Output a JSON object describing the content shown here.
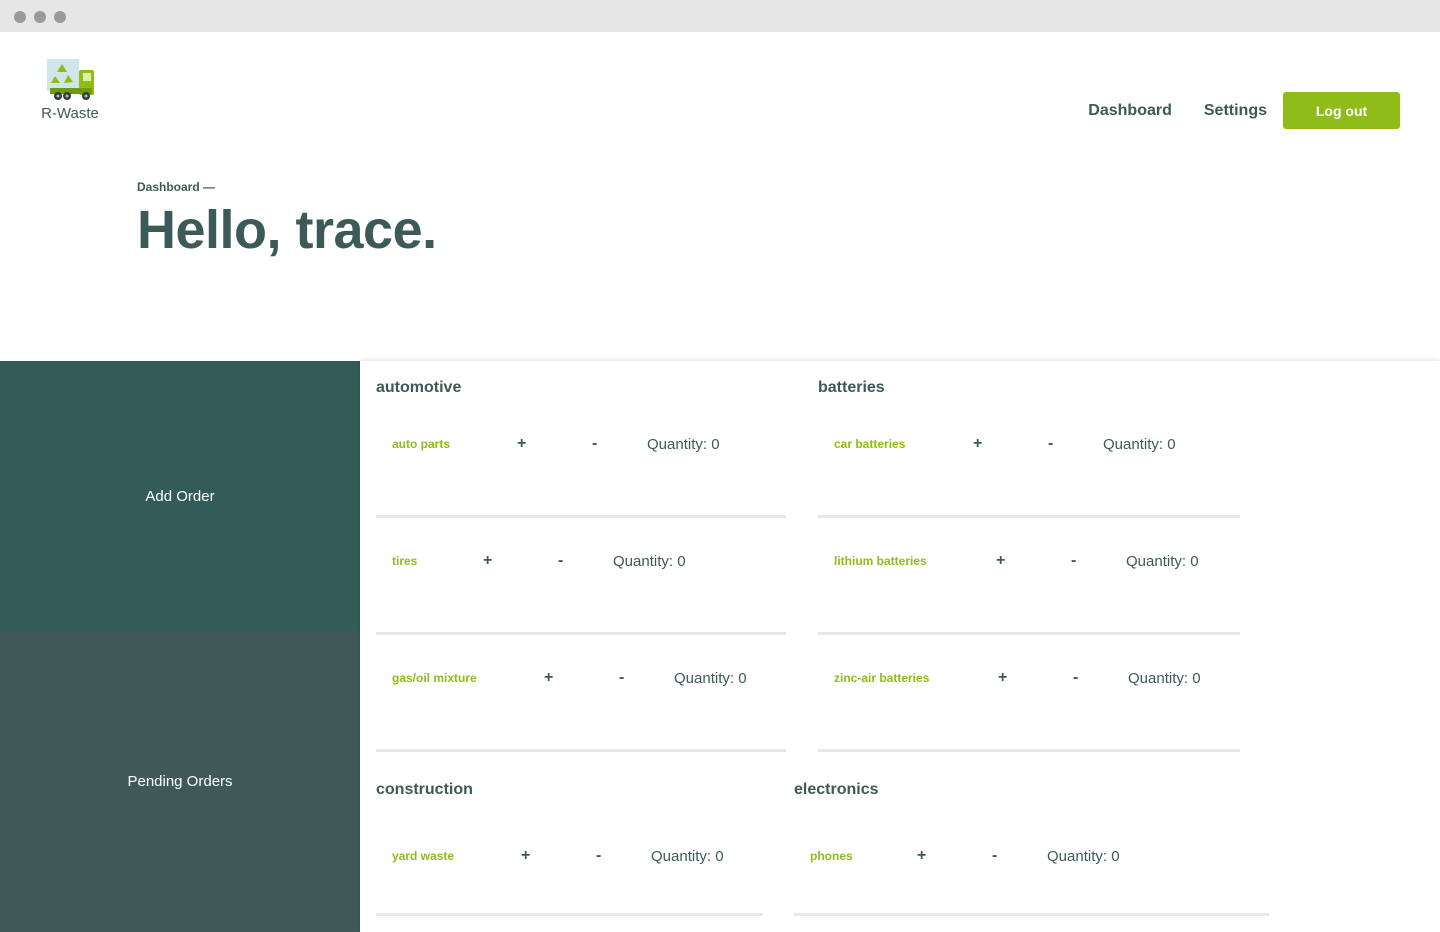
{
  "brand": {
    "name": "R-Waste",
    "logo_icon": "recycling-truck-icon",
    "accent": "#8fbc19",
    "primary": "#3d5a58"
  },
  "nav": {
    "dashboard": "Dashboard",
    "settings": "Settings",
    "logout": "Log out"
  },
  "header": {
    "breadcrumb": "Dashboard —",
    "greeting": "Hello, trace."
  },
  "sidebar": {
    "add_order": "Add Order",
    "pending_orders": "Pending Orders"
  },
  "categories": [
    {
      "title": "automotive",
      "items": [
        {
          "name": "auto parts",
          "plus": "+",
          "minus": "-",
          "quantity": "Quantity: 0"
        },
        {
          "name": "tires",
          "plus": "+",
          "minus": "-",
          "quantity": "Quantity: 0"
        },
        {
          "name": "gas/oil mixture",
          "plus": "+",
          "minus": "-",
          "quantity": "Quantity: 0"
        }
      ]
    },
    {
      "title": "batteries",
      "items": [
        {
          "name": "car batteries",
          "plus": "+",
          "minus": "-",
          "quantity": "Quantity: 0"
        },
        {
          "name": "lithium batteries",
          "plus": "+",
          "minus": "-",
          "quantity": "Quantity: 0"
        },
        {
          "name": "zinc-air batteries",
          "plus": "+",
          "minus": "-",
          "quantity": "Quantity: 0"
        }
      ]
    },
    {
      "title": "construction",
      "items": [
        {
          "name": "yard waste",
          "plus": "+",
          "minus": "-",
          "quantity": "Quantity: 0"
        }
      ]
    },
    {
      "title": "electronics",
      "items": [
        {
          "name": "phones",
          "plus": "+",
          "minus": "-",
          "quantity": "Quantity: 0"
        }
      ]
    }
  ]
}
